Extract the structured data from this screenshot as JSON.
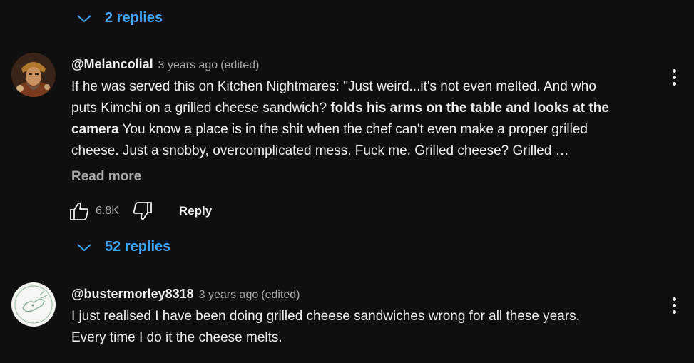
{
  "top_replies": {
    "label": "2 replies",
    "icon": "chevron-down-icon",
    "color": "#3ea6ff"
  },
  "comments": [
    {
      "author": "@Melancolial",
      "time": "3 years ago",
      "edited": "(edited)",
      "lines": [
        [
          "If he was served this on Kitchen Nightmares: \"Just weird...it's not even melted. And who"
        ],
        [
          "puts Kimchi on a grilled cheese sandwich? ",
          "folds his arms on the table and looks at the"
        ],
        [
          "camera",
          " You know a place is in the shit when the chef can't even make a proper grilled"
        ],
        [
          "cheese. Just a snobby, overcomplicated mess. Fuck me. Grilled cheese? Grilled …"
        ]
      ],
      "read_more": "Read more",
      "likes": "6.8K",
      "reply_label": "Reply",
      "replies_label": "52 replies",
      "avatar_icon": "portrait-avatar",
      "menu_icon": "more-vertical-icon"
    },
    {
      "author": "@bustermorley8318",
      "time": "3 years ago",
      "edited": "(edited)",
      "lines": [
        [
          "I just realised I have been doing grilled cheese sandwiches wrong for all these years."
        ],
        [
          "Every time I do it the cheese melts."
        ]
      ],
      "avatar_icon": "sketch-avatar",
      "menu_icon": "more-vertical-icon"
    }
  ],
  "colors": {
    "background": "#0f0f0f",
    "text": "#f1f1f1",
    "muted": "#aaaaaa",
    "link": "#3ea6ff"
  }
}
